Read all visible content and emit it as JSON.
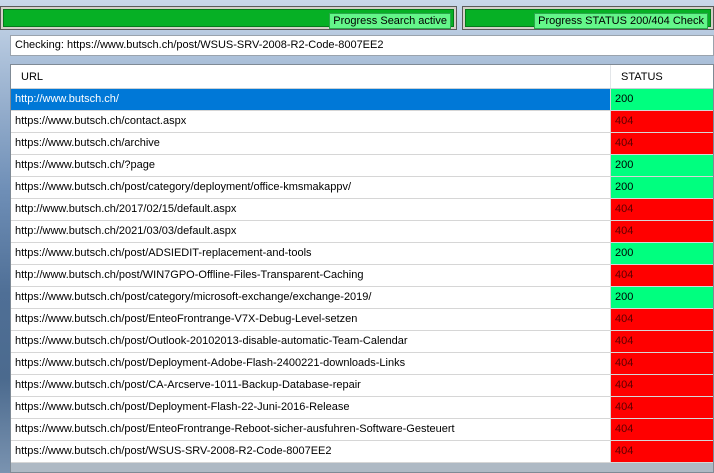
{
  "progress": {
    "search": {
      "label": "Progress Search active",
      "level": 1.0
    },
    "status_check": {
      "label": "Progress STATUS 200/404 Check",
      "level": 1.0
    }
  },
  "checking": {
    "text": "Checking: https://www.butsch.ch/post/WSUS-SRV-2008-R2-Code-8007EE2"
  },
  "grid": {
    "columns": [
      "URL",
      "STATUS"
    ],
    "selected_row": 0,
    "colors": {
      "ok": "#00ff7f",
      "error": "#ff0000",
      "selection": "#0078d7"
    },
    "rows": [
      {
        "url": "http://www.butsch.ch/",
        "status": "200"
      },
      {
        "url": "https://www.butsch.ch/contact.aspx",
        "status": "404"
      },
      {
        "url": "https://www.butsch.ch/archive",
        "status": "404"
      },
      {
        "url": "https://www.butsch.ch/?page",
        "status": "200"
      },
      {
        "url": "https://www.butsch.ch/post/category/deployment/office-kmsmakappv/",
        "status": "200"
      },
      {
        "url": "http://www.butsch.ch/2017/02/15/default.aspx",
        "status": "404"
      },
      {
        "url": "http://www.butsch.ch/2021/03/03/default.aspx",
        "status": "404"
      },
      {
        "url": "https://www.butsch.ch/post/ADSIEDIT-replacement-and-tools",
        "status": "200"
      },
      {
        "url": "http://www.butsch.ch/post/WIN7GPO-Offline-Files-Transparent-Caching",
        "status": "404"
      },
      {
        "url": "https://www.butsch.ch/post/category/microsoft-exchange/exchange-2019/",
        "status": "200"
      },
      {
        "url": "https://www.butsch.ch/post/EnteoFrontrange-V7X-Debug-Level-setzen",
        "status": "404"
      },
      {
        "url": "https://www.butsch.ch/post/Outlook-20102013-disable-automatic-Team-Calendar",
        "status": "404"
      },
      {
        "url": "https://www.butsch.ch/post/Deployment-Adobe-Flash-2400221-downloads-Links",
        "status": "404"
      },
      {
        "url": "https://www.butsch.ch/post/CA-Arcserve-1011-Backup-Database-repair",
        "status": "404"
      },
      {
        "url": "https://www.butsch.ch/post/Deployment-Flash-22-Juni-2016-Release",
        "status": "404"
      },
      {
        "url": "https://www.butsch.ch/post/EnteoFrontrange-Reboot-sicher-ausfuhren-Software-Gesteuert",
        "status": "404"
      },
      {
        "url": "https://www.butsch.ch/post/WSUS-SRV-2008-R2-Code-8007EE2",
        "status": "404"
      }
    ]
  }
}
